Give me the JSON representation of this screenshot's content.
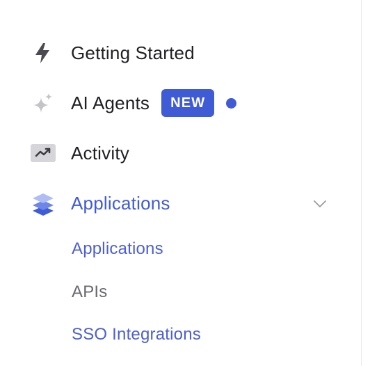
{
  "sidebar": {
    "items": [
      {
        "label": "Getting Started",
        "icon": "lightning-icon"
      },
      {
        "label": "AI Agents",
        "icon": "sparkle-icon",
        "badge": "NEW"
      },
      {
        "label": "Activity",
        "icon": "trend-chart-icon"
      },
      {
        "label": "Applications",
        "icon": "layers-icon",
        "expanded": true
      }
    ],
    "submenu": [
      {
        "label": "Applications"
      },
      {
        "label": "APIs"
      },
      {
        "label": "SSO Integrations"
      }
    ]
  },
  "colors": {
    "accent": "#3f5bd6",
    "text": "#1f1f24",
    "muted": "#686870"
  }
}
